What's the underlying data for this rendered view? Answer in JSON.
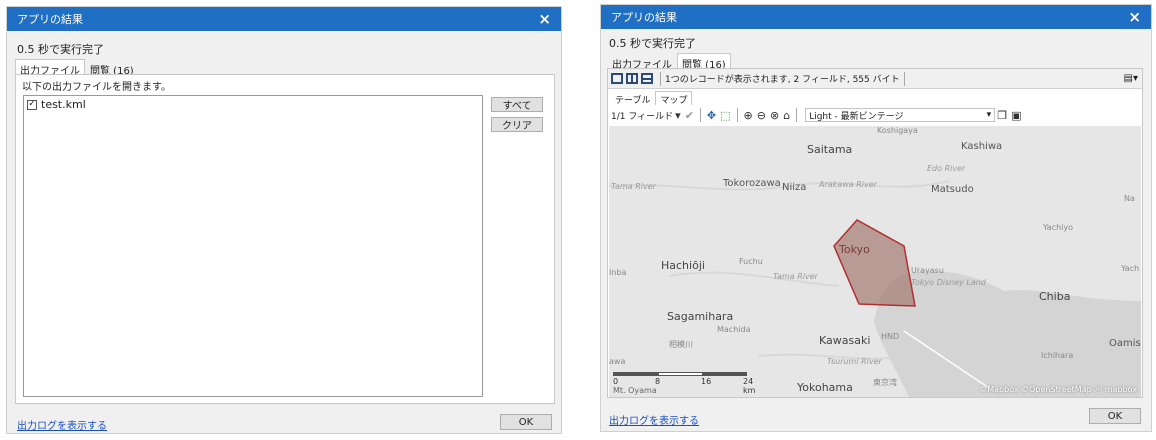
{
  "left": {
    "title": "アプリの結果",
    "close": "×",
    "runtime": "0.5 秒で実行完了",
    "tabs": [
      "出力ファイル",
      "閲覧 (16)"
    ],
    "instruction": "以下の出力ファイルを開きます。",
    "files": [
      {
        "name": "test.kml",
        "checked": true
      }
    ],
    "check_mark": "✓",
    "buttons": {
      "all": "すべて",
      "clear": "クリア"
    },
    "log_link": "出力ログを表示する",
    "ok": "OK"
  },
  "right": {
    "title": "アプリの結果",
    "close": "×",
    "runtime": "0.5 秒で実行完了",
    "tabs": [
      "出力ファイル",
      "閲覧 (16)"
    ],
    "record_info": "1つのレコードが表示されます, 2 フィールド, 555 バイト",
    "subtabs": [
      "テーブル",
      "マップ"
    ],
    "field_select": "1/1 フィールド",
    "style_select": "Light - 最新ビンテージ",
    "map_labels": {
      "koshigaya": "Koshigaya",
      "saitama": "Saitama",
      "kashiwa": "Kashiwa",
      "edo_river": "Edo River",
      "tama_river": "Tama River",
      "tokorozawa": "Tokorozawa",
      "niiza": "Niiza",
      "arakawa_river": "Arakawa River",
      "matsudo": "Matsudo",
      "na": "Na",
      "yachiyo": "Yachiyo",
      "tokyo": "Tokyo",
      "hachioji": "Hachiōji",
      "fuchu": "Fuchu",
      "urayasu": "Urayasu",
      "tokyo_disney": "Tokyo Disney Land",
      "yach": "Yach",
      "inba": "Inba",
      "tama_river_2": "Tama River",
      "chiba": "Chiba",
      "sagamihara": "Sagamihara",
      "machida": "Machida",
      "kawasaki": "Kawasaki",
      "hnd": "HND",
      "oamis": "Oamis",
      "ichihara": "Ichihara",
      "tsurumi_river": "Tsurumi River",
      "yokohama": "Yokohama",
      "sagamihara_jp": "相模川",
      "tokyo_bay_jp": "東京湾",
      "awa": "awa",
      "mt_oyama": "Mt. Oyama"
    },
    "scale_labels": [
      "0",
      "8",
      "16",
      "24 km"
    ],
    "attribution": "©Mapbox ©OpenStreetMap ⓜ mapbox",
    "log_link": "出力ログを表示する",
    "ok": "OK"
  },
  "colors": {
    "titlebar": "#1f6fc5",
    "polygon_fill": "#a57a72",
    "polygon_stroke": "#b03030",
    "water": "#d4d4d4",
    "land": "#e6e6e6"
  }
}
